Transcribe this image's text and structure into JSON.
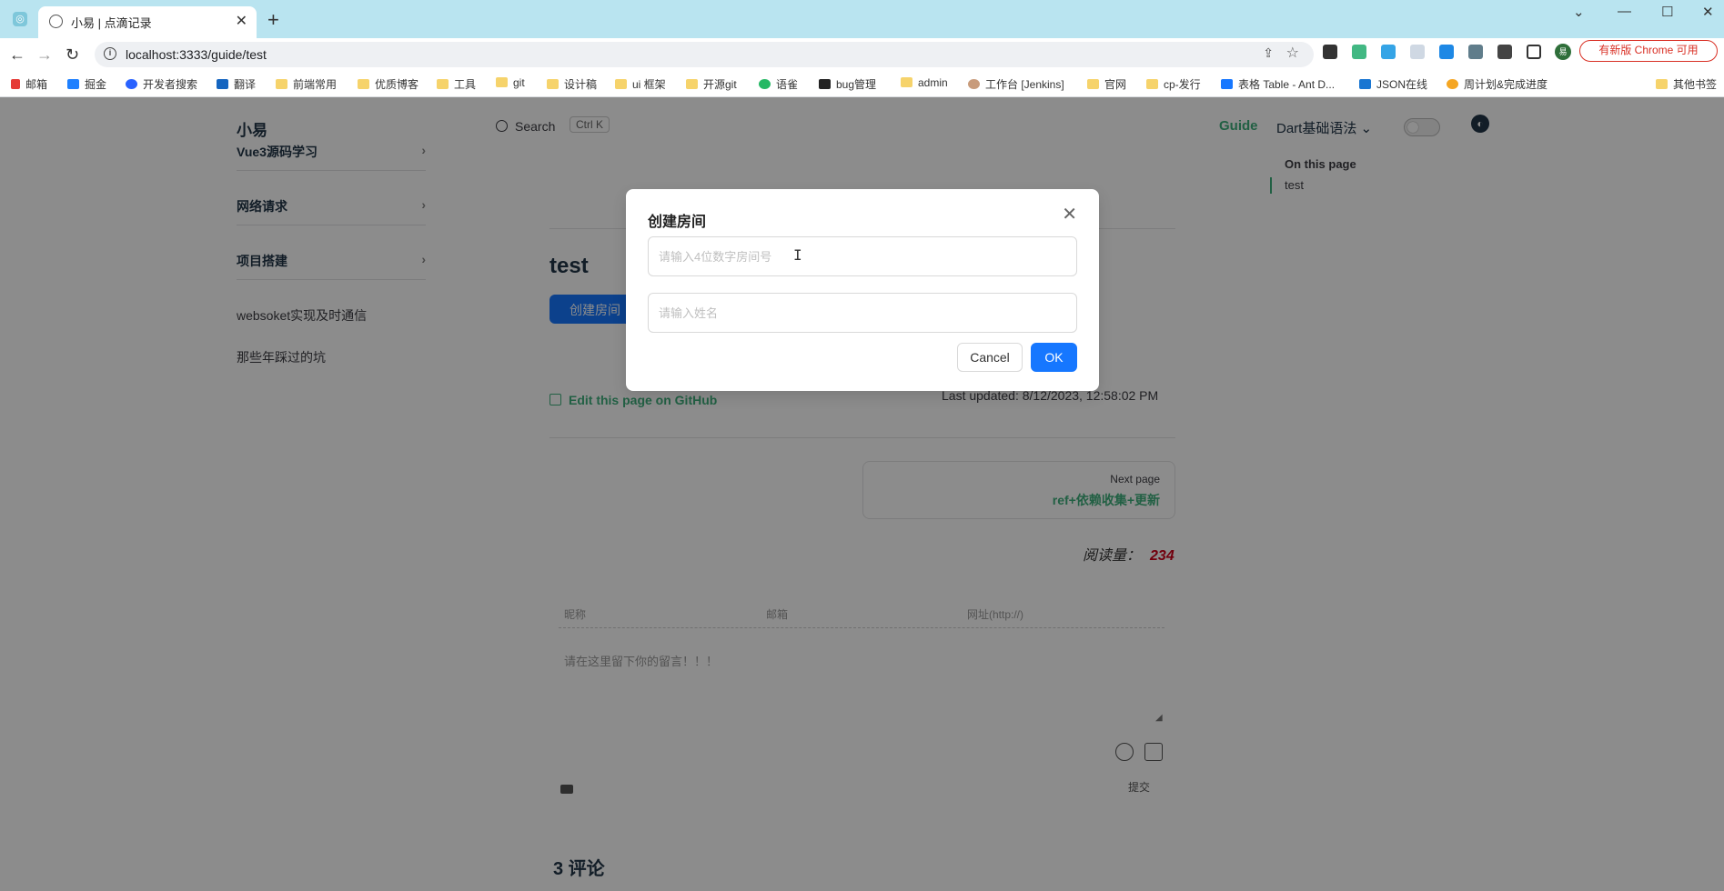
{
  "browser": {
    "tab_title": "小易 | 点滴记录",
    "url": "localhost:3333/guide/test",
    "update_button": "有新版 Chrome 可用",
    "profile_initial": "易",
    "bookmarks": [
      "邮箱",
      "掘金",
      "开发者搜索",
      "翻译",
      "前端常用",
      "优质博客",
      "工具",
      "git",
      "设计稿",
      "ui 框架",
      "开源git",
      "语雀",
      "bug管理",
      "admin",
      "工作台 [Jenkins]",
      "官网",
      "cp-发行",
      "表格 Table - Ant D...",
      "JSON在线",
      "周计划&完成进度",
      "其他书签"
    ]
  },
  "site": {
    "brand": "小易",
    "search_label": "Search",
    "search_shortcut": "Ctrl K",
    "nav_guide": "Guide",
    "nav_dart": "Dart基础语法"
  },
  "sidebar": {
    "groups": [
      "Vue3源码学习",
      "网络请求",
      "项目搭建"
    ],
    "items": [
      "websoket实现及时通信",
      "那些年踩过的坑"
    ]
  },
  "content": {
    "title": "test",
    "create_button": "创建房间",
    "edit_link": "Edit this page on GitHub",
    "last_updated": "Last updated: 8/12/2023, 12:58:02 PM",
    "next_label": "Next page",
    "next_title": "ref+依赖收集+更新",
    "reads_label": "阅读量：",
    "reads_count": "234",
    "comment_nick": "昵称",
    "comment_mail": "邮箱",
    "comment_site": "网址(http://)",
    "comment_placeholder": "请在这里留下你的留言！！！",
    "submit": "提交",
    "comments_count": "3 评论"
  },
  "aside": {
    "title": "On this page",
    "link": "test"
  },
  "modal": {
    "title": "创建房间",
    "room_placeholder": "请输入4位数字房间号",
    "name_placeholder": "请输入姓名",
    "cancel": "Cancel",
    "ok": "OK"
  },
  "colors": {
    "brand_green": "#3eaf7c",
    "primary_blue": "#1677ff",
    "reads_red": "#d0021b",
    "tabbar": "#b9e4f0"
  }
}
